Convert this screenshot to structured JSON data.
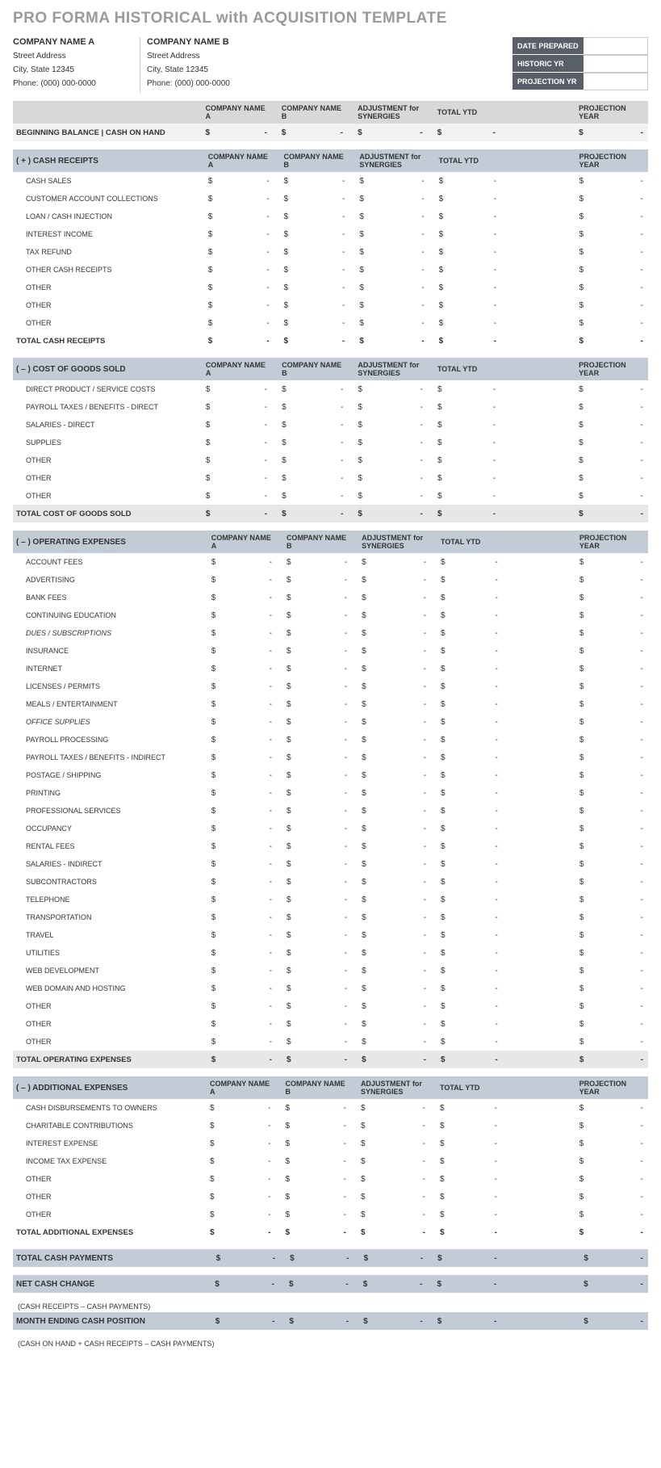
{
  "title": "PRO FORMA HISTORICAL with ACQUISITION TEMPLATE",
  "companies": {
    "a": {
      "name": "COMPANY NAME A",
      "street": "Street Address",
      "city": "City, State  12345",
      "phone": "Phone: (000) 000-0000"
    },
    "b": {
      "name": "COMPANY NAME B",
      "street": "Street Address",
      "city": "City, State  12345",
      "phone": "Phone: (000) 000-0000"
    }
  },
  "date_box": [
    {
      "label": "DATE PREPARED",
      "value": ""
    },
    {
      "label": "HISTORIC YR",
      "value": ""
    },
    {
      "label": "PROJECTION YR",
      "value": ""
    }
  ],
  "columns": [
    "COMPANY NAME A",
    "COMPANY NAME B",
    "ADJUSTMENT for SYNERGIES",
    "TOTAL YTD",
    "",
    "PROJECTION YEAR"
  ],
  "currency": "$",
  "dash": "-",
  "beginning_balance_label": "BEGINNING BALANCE  |  CASH ON HAND",
  "sections": [
    {
      "id": "cash_receipts",
      "title": "( + )  CASH RECEIPTS",
      "rows": [
        "CASH SALES",
        "CUSTOMER ACCOUNT COLLECTIONS",
        "LOAN / CASH INJECTION",
        "INTEREST INCOME",
        "TAX REFUND",
        "OTHER CASH RECEIPTS",
        "OTHER",
        "OTHER",
        "OTHER"
      ],
      "total": "TOTAL CASH RECEIPTS",
      "total_style": "total-row"
    },
    {
      "id": "cogs",
      "title": "( – )  COST OF GOODS SOLD",
      "rows": [
        "DIRECT PRODUCT / SERVICE COSTS",
        "PAYROLL TAXES / BENEFITS - DIRECT",
        "SALARIES - DIRECT",
        "SUPPLIES",
        "OTHER",
        "OTHER",
        "OTHER"
      ],
      "total": "TOTAL COST OF GOODS SOLD",
      "total_style": "total-opex"
    },
    {
      "id": "opex",
      "title": "( – )  OPERATING EXPENSES",
      "rows": [
        "ACCOUNT FEES",
        "ADVERTISING",
        "BANK FEES",
        "CONTINUING EDUCATION",
        "DUES / SUBSCRIPTIONS",
        "INSURANCE",
        "INTERNET",
        "LICENSES / PERMITS",
        "MEALS / ENTERTAINMENT",
        "OFFICE SUPPLIES",
        "PAYROLL PROCESSING",
        "PAYROLL TAXES / BENEFITS - INDIRECT",
        "POSTAGE / SHIPPING",
        "PRINTING",
        "PROFESSIONAL SERVICES",
        "OCCUPANCY",
        "RENTAL FEES",
        "SALARIES - INDIRECT",
        "SUBCONTRACTORS",
        "TELEPHONE",
        "TRANSPORTATION",
        "TRAVEL",
        "UTILITIES",
        "WEB DEVELOPMENT",
        "WEB DOMAIN AND HOSTING",
        "OTHER",
        "OTHER",
        "OTHER"
      ],
      "italic_rows": [
        "DUES / SUBSCRIPTIONS",
        "OFFICE SUPPLIES"
      ],
      "total": "TOTAL OPERATING EXPENSES",
      "total_style": "total-opex"
    },
    {
      "id": "additional",
      "title": "( – )  ADDITIONAL EXPENSES",
      "rows": [
        "CASH DISBURSEMENTS TO OWNERS",
        "CHARITABLE CONTRIBUTIONS",
        "INTEREST EXPENSE",
        "INCOME TAX EXPENSE",
        "OTHER",
        "OTHER",
        "OTHER"
      ],
      "total": "TOTAL ADDITIONAL EXPENSES",
      "total_style": "total-row"
    }
  ],
  "summaries": [
    {
      "label": "TOTAL CASH PAYMENTS",
      "note": ""
    },
    {
      "label": "NET CASH CHANGE",
      "note": "(CASH RECEIPTS – CASH PAYMENTS)"
    },
    {
      "label": "MONTH ENDING CASH POSITION",
      "note": "(CASH ON HAND + CASH RECEIPTS – CASH PAYMENTS)"
    }
  ]
}
